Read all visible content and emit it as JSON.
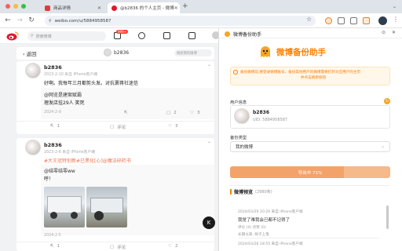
{
  "browser": {
    "tabs": [
      {
        "label": "商品详情"
      },
      {
        "label": "@b2836 的个人主页 - 微博"
      }
    ],
    "new_tab": "+",
    "url": "weibo.com/u/5884958587"
  },
  "weibo": {
    "search_placeholder": "搜索微博",
    "notif_badge": "999+",
    "back_label": "返回",
    "profile_name": "b2836",
    "inner_search_placeholder": "搜索我的微博",
    "posts": [
      {
        "name": "b2836",
        "meta": "2023-2-10 来自 iPhone客户端",
        "text": "好啊。我每年三月都剪头发。对抗裹蒋社迷信",
        "repost_user": "@网览是建案赋霸",
        "repost_text": "理发店挂29人 笑死",
        "repost_date": "2024-2-9",
        "stats": {
          "share": "1",
          "comment": "评论",
          "like": "3"
        },
        "inner_stats": {
          "share": "",
          "comment": "2",
          "like": "3"
        }
      },
      {
        "name": "b2836",
        "meta": "2023-2-6 来自 iPhone客户端",
        "link_line": "#大王冠特别新#已黑化[心]@魔法碎药书",
        "repost_user": "@结零结零ww",
        "repost_text": "呼！",
        "repost_date": "2024-2-5",
        "stats": {
          "share": "1",
          "comment": "评论",
          "like": "2"
        },
        "floating_badge": "K"
      }
    ]
  },
  "panel": {
    "header_title": "微博备份助手",
    "big_title": "微博备份助手",
    "notice_line1": "备份微博前,要登录微博账号。备份其他用户的微博需要打开对应用户的主页",
    "notice_line2": "并点击刷新按钮",
    "user_section": "用户信息",
    "user_name": "b2836",
    "user_uid": "UID: 5884958587",
    "type_section": "备份类型",
    "type_value": "我的微博",
    "progress_label": "导出中 71%",
    "progress_value": 0.71,
    "preview_title": "微博预览",
    "preview_count": "(2980条)",
    "preview_items": [
      {
        "meta": "2024/03/29 20:20 来自 iPhone客户端",
        "text": "我觉了难我会已都不记得了",
        "actions": "评论 (0)   点赞 (0)"
      },
      {
        "meta": "",
        "text": "",
        "actions": "长期以来, 样子上落"
      },
      {
        "meta": "2024/03/26 18:55 来自 iPhone客户端",
        "text": "",
        "actions": ""
      }
    ]
  },
  "colors": {
    "accent": "#ff8200",
    "progress_fill": "#f3a36a",
    "progress_track": "#f5b98a",
    "link": "#eb7350",
    "weibo_red": "#e6162d"
  }
}
